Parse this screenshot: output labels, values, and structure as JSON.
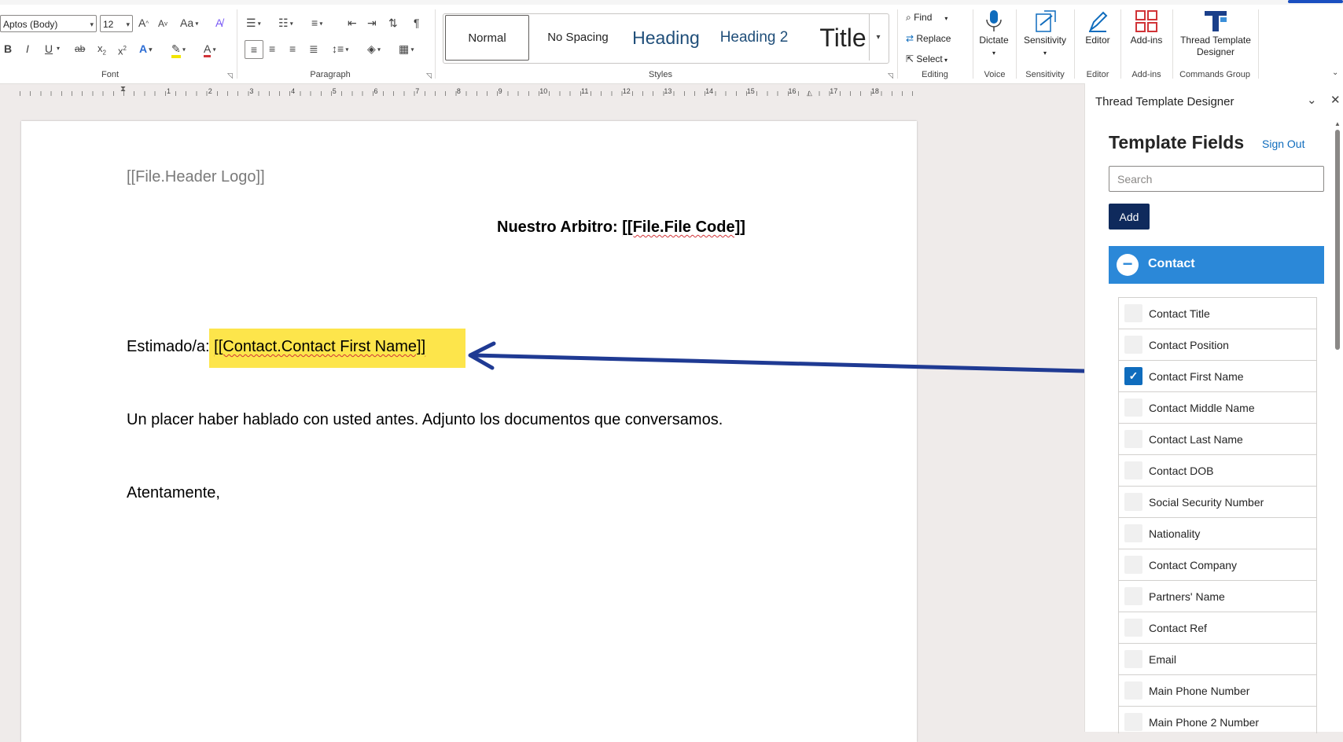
{
  "ribbon": {
    "font": {
      "group_label": "Font",
      "font_name": "Aptos (Body)",
      "font_size": "12",
      "grow": "A",
      "shrink": "A",
      "case": "Aa",
      "bold": "B",
      "italic": "I",
      "underline": "U",
      "strike": "ab",
      "subscript": "x",
      "superscript": "x",
      "text_effects": "A",
      "font_color": "A"
    },
    "paragraph": {
      "group_label": "Paragraph",
      "pilcrow": "¶"
    },
    "styles": {
      "group_label": "Styles",
      "items": [
        {
          "label": "Normal"
        },
        {
          "label": "No Spacing"
        },
        {
          "label": "Heading"
        },
        {
          "label": "Heading 2"
        },
        {
          "label": "Title"
        }
      ]
    },
    "editing": {
      "group_label": "Editing",
      "find": "Find",
      "replace": "Replace",
      "select": "Select"
    },
    "voice": {
      "group_label": "Voice",
      "dictate": "Dictate"
    },
    "sensitivity": {
      "group_label": "Sensitivity",
      "label": "Sensitivity"
    },
    "editor": {
      "group_label": "Editor",
      "label": "Editor"
    },
    "addins": {
      "group_label": "Add-ins",
      "label": "Add-ins"
    },
    "commands": {
      "group_label": "Commands Group",
      "line1": "Thread Template",
      "line2": "Designer"
    }
  },
  "ruler": {
    "numbers": [
      "1",
      "2",
      "3",
      "4",
      "5",
      "6",
      "7",
      "8",
      "9",
      "10",
      "11",
      "12",
      "13",
      "14",
      "15",
      "16",
      "17",
      "18"
    ]
  },
  "document": {
    "header_logo": "[[File.Header Logo]]",
    "arbitro_prefix": "Nuestro Arbitro: ",
    "arbitro_field": "[[File.File Code]]",
    "salutation_prefix": "Estimado/a: ",
    "salutation_field": "[[Contact.Contact First Name]]",
    "body": "Un placer haber hablado con usted antes. Adjunto los documentos que conversamos.",
    "closing": "Atentamente,"
  },
  "pane": {
    "title": "Thread Template Designer",
    "heading": "Template Fields",
    "sign_out": "Sign Out",
    "search_placeholder": "Search",
    "add_label": "Add",
    "section_label": "Contact",
    "fields": [
      {
        "label": "Contact Title",
        "checked": false
      },
      {
        "label": "Contact Position",
        "checked": false
      },
      {
        "label": "Contact First Name",
        "checked": true
      },
      {
        "label": "Contact Middle Name",
        "checked": false
      },
      {
        "label": "Contact Last Name",
        "checked": false
      },
      {
        "label": "Contact DOB",
        "checked": false
      },
      {
        "label": "Social Security Number",
        "checked": false
      },
      {
        "label": "Nationality",
        "checked": false
      },
      {
        "label": "Contact Company",
        "checked": false
      },
      {
        "label": "Partners' Name",
        "checked": false
      },
      {
        "label": "Contact Ref",
        "checked": false
      },
      {
        "label": "Email",
        "checked": false
      },
      {
        "label": "Main Phone Number",
        "checked": false
      },
      {
        "label": "Main Phone 2 Number",
        "checked": false
      }
    ]
  },
  "colors": {
    "accent": "#2b88d8",
    "add_button": "#0f2a5c",
    "highlight": "#fde54b",
    "arrow": "#1f3a93"
  }
}
